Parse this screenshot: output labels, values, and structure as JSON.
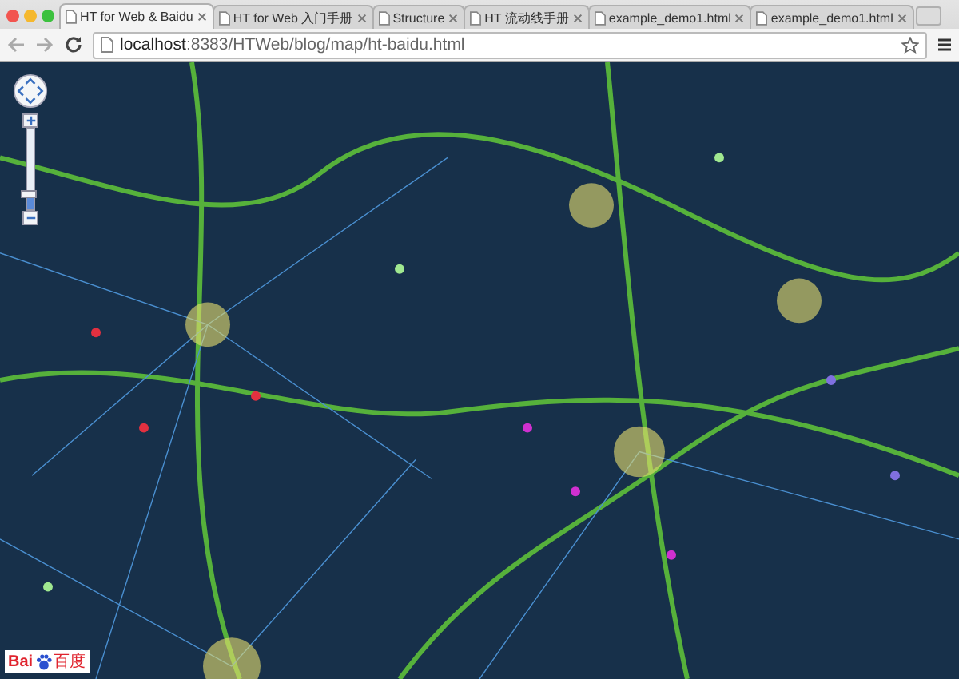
{
  "tabs": [
    {
      "title": "HT for Web & Baidu",
      "selected": true
    },
    {
      "title": "HT for Web 入门手册",
      "selected": false
    },
    {
      "title": "Structure",
      "selected": false
    },
    {
      "title": "HT 流动线手册",
      "selected": false
    },
    {
      "title": "example_demo1.html",
      "selected": false
    },
    {
      "title": "example_demo1.html",
      "selected": false
    }
  ],
  "address_bar": {
    "host": "localhost",
    "path": ":8383/HTWeb/blog/map/ht-baidu.html"
  },
  "map": {
    "zoom_slider": {
      "level": 0.2
    },
    "logo": {
      "part_1": "Bai",
      "part_2": "百度"
    }
  }
}
